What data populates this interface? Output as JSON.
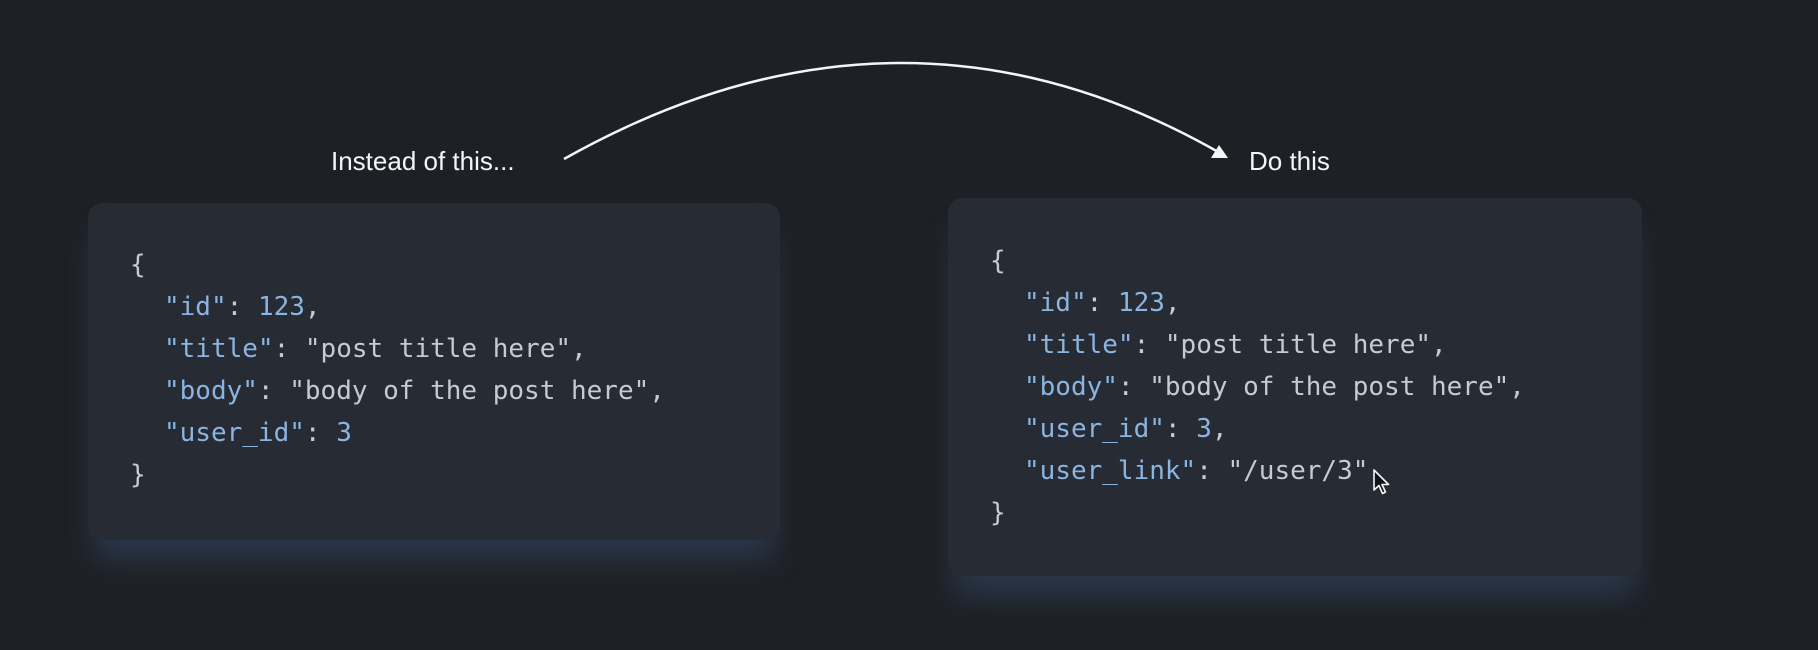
{
  "captions": {
    "left": "Instead of this...",
    "right": "Do this"
  },
  "left_code": {
    "open": "{",
    "close": "}",
    "lines": [
      {
        "key": "\"id\"",
        "sep": ": ",
        "value": "123",
        "value_type": "num",
        "trail": ","
      },
      {
        "key": "\"title\"",
        "sep": ": ",
        "value": "\"post title here\"",
        "value_type": "str",
        "trail": ","
      },
      {
        "key": "\"body\"",
        "sep": ": ",
        "value": "\"body of the post here\"",
        "value_type": "str",
        "trail": ","
      },
      {
        "key": "\"user_id\"",
        "sep": ": ",
        "value": "3",
        "value_type": "num",
        "trail": ""
      }
    ]
  },
  "right_code": {
    "open": "{",
    "close": "}",
    "lines": [
      {
        "key": "\"id\"",
        "sep": ": ",
        "value": "123",
        "value_type": "num",
        "trail": ","
      },
      {
        "key": "\"title\"",
        "sep": ": ",
        "value": "\"post title here\"",
        "value_type": "str",
        "trail": ","
      },
      {
        "key": "\"body\"",
        "sep": ": ",
        "value": "\"body of the post here\"",
        "value_type": "str",
        "trail": ","
      },
      {
        "key": "\"user_id\"",
        "sep": ": ",
        "value": "3",
        "value_type": "num",
        "trail": ","
      },
      {
        "key": "\"user_link\"",
        "sep": ": ",
        "value": "\"/user/3\"",
        "value_type": "str",
        "trail": ""
      }
    ]
  },
  "colors": {
    "background": "#1e2025",
    "card": "#262b34",
    "key": "#8cb4e0",
    "text": "#c5cad3",
    "caption": "#f4f5f7"
  },
  "icons": {
    "arrow": "curved-arrow-icon",
    "cursor": "mouse-pointer-icon"
  }
}
